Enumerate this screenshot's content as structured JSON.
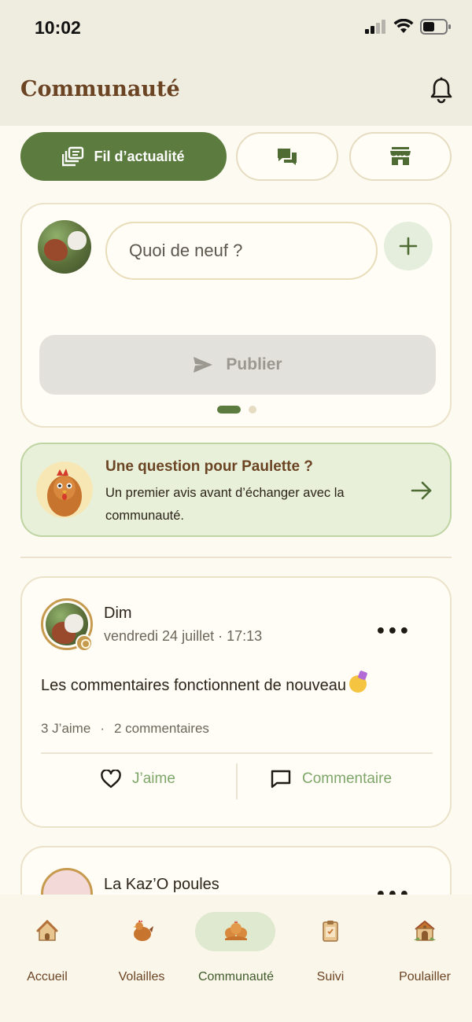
{
  "status_bar": {
    "time": "10:02"
  },
  "header": {
    "title": "Communauté"
  },
  "tabs": [
    {
      "label": "Fil d’actualité",
      "icon": "feed-icon",
      "active": true
    },
    {
      "label": "",
      "icon": "chat-icon",
      "active": false
    },
    {
      "label": "",
      "icon": "store-icon",
      "active": false
    }
  ],
  "composer": {
    "placeholder": "Quoi de neuf ?",
    "publish_label": "Publier",
    "page_count": 2,
    "current_page": 1
  },
  "paulette": {
    "title": "Une question pour Paulette ?",
    "subtitle": "Un premier avis avant d’échanger avec la communauté."
  },
  "posts": [
    {
      "author": "Dim",
      "date": "vendredi 24 juillet · 17:13",
      "text": "Les commentaires fonctionnent de nouveau",
      "likes": "3 J’aime",
      "separator": "·",
      "comments": "2 commentaires",
      "like_label": "J’aime",
      "comment_label": "Commentaire"
    },
    {
      "author": "La Kaz’O poules"
    }
  ],
  "bottom_nav": [
    {
      "label": "Accueil",
      "icon": "home-icon",
      "active": false
    },
    {
      "label": "Volailles",
      "icon": "chicken-icon",
      "active": false
    },
    {
      "label": "Communauté",
      "icon": "community-icon",
      "active": true
    },
    {
      "label": "Suivi",
      "icon": "clipboard-icon",
      "active": false
    },
    {
      "label": "Poulailler",
      "icon": "coop-icon",
      "active": false
    }
  ],
  "colors": {
    "primary": "#5c7c3f",
    "brown": "#6b4424",
    "background": "#fdfaf1",
    "accent_green_light": "#e8f0da"
  }
}
